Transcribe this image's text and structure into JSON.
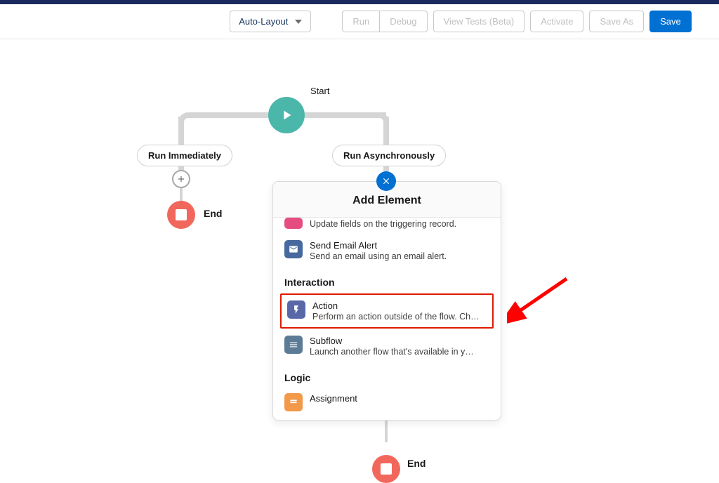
{
  "toolbar": {
    "layout_mode": "Auto-Layout",
    "run": "Run",
    "debug": "Debug",
    "view_tests": "View Tests (Beta)",
    "activate": "Activate",
    "save_as": "Save As",
    "save": "Save"
  },
  "flow": {
    "type": "Record-Triggered Flow",
    "start_label": "Start",
    "branch_left": "Run Immediately",
    "branch_right": "Run Asynchronously",
    "end_label": "End"
  },
  "popover": {
    "title": "Add Element",
    "items": [
      {
        "title": "",
        "desc": "Update fields on the triggering record."
      },
      {
        "title": "Send Email Alert",
        "desc": "Send an email using an email alert."
      }
    ],
    "section_interaction": "Interaction",
    "action": {
      "title": "Action",
      "desc": "Perform an action outside of the flow. Ch…"
    },
    "subflow": {
      "title": "Subflow",
      "desc": "Launch another flow that's available in y…"
    },
    "section_logic": "Logic",
    "assignment": {
      "title": "Assignment"
    }
  }
}
